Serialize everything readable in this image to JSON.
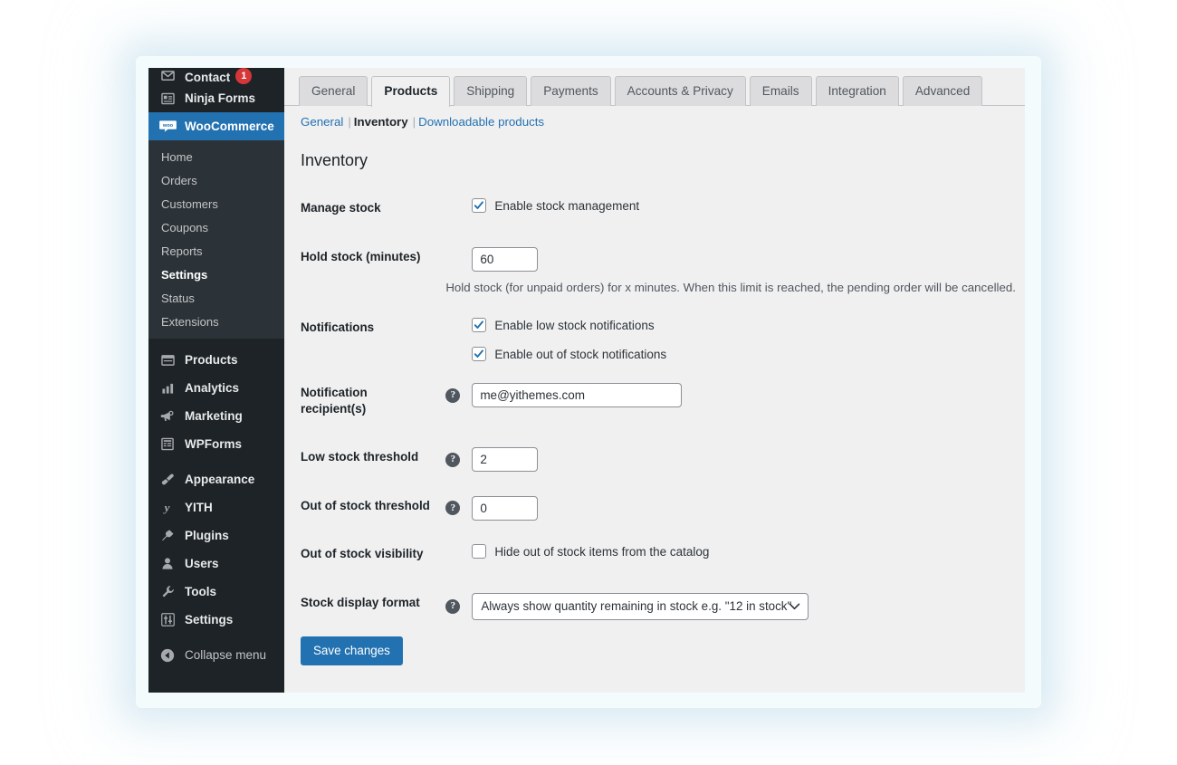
{
  "sidebar": {
    "top_items": [
      {
        "label": "Contact",
        "icon": "mail-icon",
        "badge": "1",
        "clipped": true
      },
      {
        "label": "Ninja Forms",
        "icon": "form-icon",
        "badge": "",
        "clipped": false
      }
    ],
    "current_item": {
      "label": "WooCommerce",
      "icon": "woocommerce-icon"
    },
    "submenu": [
      {
        "label": "Home",
        "active": false
      },
      {
        "label": "Orders",
        "active": false
      },
      {
        "label": "Customers",
        "active": false
      },
      {
        "label": "Coupons",
        "active": false
      },
      {
        "label": "Reports",
        "active": false
      },
      {
        "label": "Settings",
        "active": true
      },
      {
        "label": "Status",
        "active": false
      },
      {
        "label": "Extensions",
        "active": false
      }
    ],
    "group_two": [
      {
        "label": "Products",
        "icon": "products-icon"
      },
      {
        "label": "Analytics",
        "icon": "analytics-icon"
      },
      {
        "label": "Marketing",
        "icon": "marketing-icon"
      },
      {
        "label": "WPForms",
        "icon": "wpforms-icon"
      }
    ],
    "group_three": [
      {
        "label": "Appearance",
        "icon": "appearance-icon"
      },
      {
        "label": "YITH",
        "icon": "yith-icon"
      },
      {
        "label": "Plugins",
        "icon": "plugins-icon"
      },
      {
        "label": "Users",
        "icon": "users-icon"
      },
      {
        "label": "Tools",
        "icon": "tools-icon"
      },
      {
        "label": "Settings",
        "icon": "settings-icon"
      }
    ],
    "collapse": {
      "label": "Collapse menu",
      "icon": "collapse-arrow-icon"
    }
  },
  "tabs": [
    {
      "label": "General",
      "active": false
    },
    {
      "label": "Products",
      "active": true
    },
    {
      "label": "Shipping",
      "active": false
    },
    {
      "label": "Payments",
      "active": false
    },
    {
      "label": "Accounts & Privacy",
      "active": false
    },
    {
      "label": "Emails",
      "active": false
    },
    {
      "label": "Integration",
      "active": false
    },
    {
      "label": "Advanced",
      "active": false
    }
  ],
  "subnav": {
    "general": "General",
    "inventory": "Inventory",
    "downloadable": "Downloadable products",
    "separator": "|"
  },
  "section": {
    "title": "Inventory"
  },
  "fields": {
    "manage_stock": {
      "label": "Manage stock",
      "checkbox_label": "Enable stock management",
      "checked": true
    },
    "hold_stock": {
      "label": "Hold stock (minutes)",
      "value": "60",
      "description": "Hold stock (for unpaid orders) for x minutes. When this limit is reached, the pending order will be cancelled."
    },
    "notifications": {
      "label": "Notifications",
      "low_stock_label": "Enable low stock notifications",
      "low_stock_checked": true,
      "out_of_stock_label": "Enable out of stock notifications",
      "out_of_stock_checked": true
    },
    "notification_recipients": {
      "label": "Notification recipient(s)",
      "value": "me@yithemes.com",
      "help": "?"
    },
    "low_stock_threshold": {
      "label": "Low stock threshold",
      "value": "2",
      "help": "?"
    },
    "out_of_stock_threshold": {
      "label": "Out of stock threshold",
      "value": "0",
      "help": "?"
    },
    "out_of_stock_visibility": {
      "label": "Out of stock visibility",
      "checkbox_label": "Hide out of stock items from the catalog",
      "checked": false
    },
    "stock_display_format": {
      "label": "Stock display format",
      "selected": "Always show quantity remaining in stock e.g. \"12 in stock\"",
      "help": "?"
    }
  },
  "actions": {
    "save_label": "Save changes"
  },
  "colors": {
    "sidebar_bg": "#1d2327",
    "submenu_bg": "#2c3338",
    "accent_blue": "#2271b1",
    "badge_red": "#d63638",
    "content_bg": "#f0f0f1",
    "link_blue": "#2271b1"
  }
}
